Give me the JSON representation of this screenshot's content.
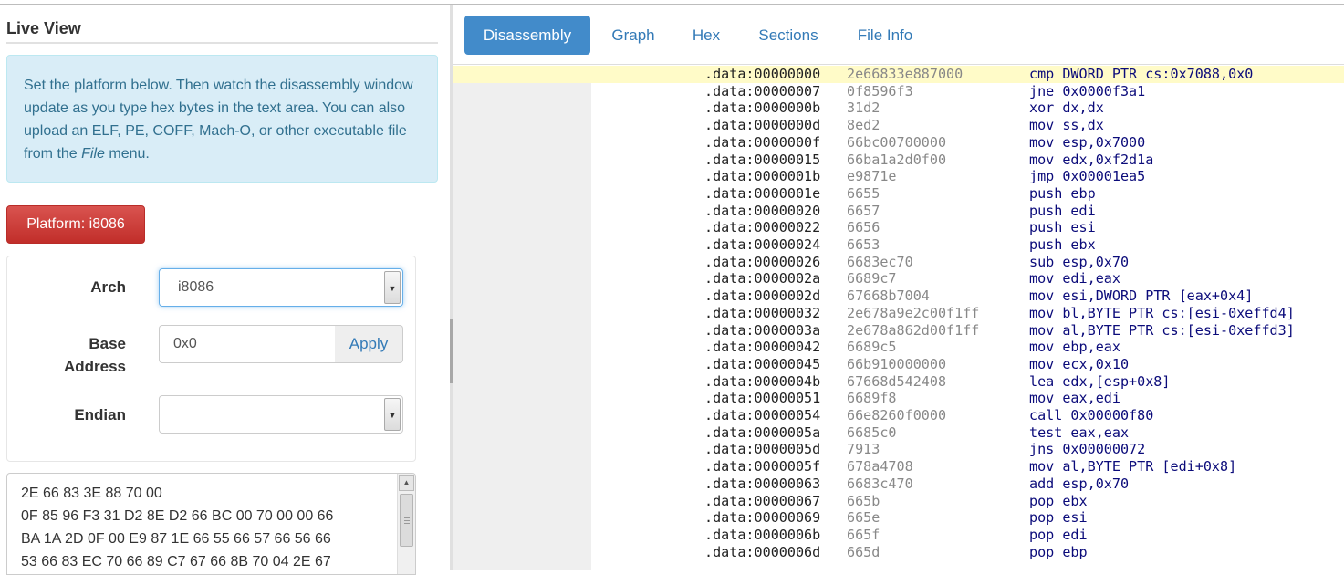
{
  "left_panel": {
    "title": "Live View",
    "info": {
      "text_before": "Set the platform below. Then watch the disassembly window update as you type hex bytes in the text area. You can also upload an ELF, PE, COFF, Mach-O, or other executable file from the ",
      "file_word": "File",
      "text_after": " menu."
    },
    "platform_button": "Platform: i8086",
    "form": {
      "arch_label": "Arch",
      "arch_value": "i8086",
      "base_label_1": "Base",
      "base_label_2": "Address",
      "base_value": "0x0",
      "apply_label": "Apply",
      "endian_label": "Endian",
      "endian_value": ""
    },
    "hex_lines": [
      "2E 66 83 3E 88 70 00",
      "0F 85 96 F3 31 D2 8E D2 66 BC 00 70 00 00 66",
      "BA 1A 2D 0F 00 E9 87 1E 66 55 66 57 66 56 66",
      "53 66 83 EC 70 66 89 C7 67 66 8B 70 04 2E 67"
    ]
  },
  "tabs": [
    "Disassembly",
    "Graph",
    "Hex",
    "Sections",
    "File Info"
  ],
  "active_tab": "Disassembly",
  "disassembly": [
    {
      "addr": ".data:00000000",
      "bytes": "2e66833e887000",
      "ins": "cmp DWORD PTR cs:0x7088,0x0"
    },
    {
      "addr": ".data:00000007",
      "bytes": "0f8596f3",
      "ins": "jne 0x0000f3a1"
    },
    {
      "addr": ".data:0000000b",
      "bytes": "31d2",
      "ins": "xor dx,dx"
    },
    {
      "addr": ".data:0000000d",
      "bytes": "8ed2",
      "ins": "mov ss,dx"
    },
    {
      "addr": ".data:0000000f",
      "bytes": "66bc00700000",
      "ins": "mov esp,0x7000"
    },
    {
      "addr": ".data:00000015",
      "bytes": "66ba1a2d0f00",
      "ins": "mov edx,0xf2d1a"
    },
    {
      "addr": ".data:0000001b",
      "bytes": "e9871e",
      "ins": "jmp 0x00001ea5"
    },
    {
      "addr": ".data:0000001e",
      "bytes": "6655",
      "ins": "push ebp"
    },
    {
      "addr": ".data:00000020",
      "bytes": "6657",
      "ins": "push edi"
    },
    {
      "addr": ".data:00000022",
      "bytes": "6656",
      "ins": "push esi"
    },
    {
      "addr": ".data:00000024",
      "bytes": "6653",
      "ins": "push ebx"
    },
    {
      "addr": ".data:00000026",
      "bytes": "6683ec70",
      "ins": "sub esp,0x70"
    },
    {
      "addr": ".data:0000002a",
      "bytes": "6689c7",
      "ins": "mov edi,eax"
    },
    {
      "addr": ".data:0000002d",
      "bytes": "67668b7004",
      "ins": "mov esi,DWORD PTR [eax+0x4]"
    },
    {
      "addr": ".data:00000032",
      "bytes": "2e678a9e2c00f1ff",
      "ins": "mov bl,BYTE PTR cs:[esi-0xeffd4]"
    },
    {
      "addr": ".data:0000003a",
      "bytes": "2e678a862d00f1ff",
      "ins": "mov al,BYTE PTR cs:[esi-0xeffd3]"
    },
    {
      "addr": ".data:00000042",
      "bytes": "6689c5",
      "ins": "mov ebp,eax"
    },
    {
      "addr": ".data:00000045",
      "bytes": "66b910000000",
      "ins": "mov ecx,0x10"
    },
    {
      "addr": ".data:0000004b",
      "bytes": "67668d542408",
      "ins": "lea edx,[esp+0x8]"
    },
    {
      "addr": ".data:00000051",
      "bytes": "6689f8",
      "ins": "mov eax,edi"
    },
    {
      "addr": ".data:00000054",
      "bytes": "66e8260f0000",
      "ins": "call 0x00000f80"
    },
    {
      "addr": ".data:0000005a",
      "bytes": "6685c0",
      "ins": "test eax,eax"
    },
    {
      "addr": ".data:0000005d",
      "bytes": "7913",
      "ins": "jns 0x00000072"
    },
    {
      "addr": ".data:0000005f",
      "bytes": "678a4708",
      "ins": "mov al,BYTE PTR [edi+0x8]"
    },
    {
      "addr": ".data:00000063",
      "bytes": "6683c470",
      "ins": "add esp,0x70"
    },
    {
      "addr": ".data:00000067",
      "bytes": "665b",
      "ins": "pop ebx"
    },
    {
      "addr": ".data:00000069",
      "bytes": "665e",
      "ins": "pop esi"
    },
    {
      "addr": ".data:0000006b",
      "bytes": "665f",
      "ins": "pop edi"
    },
    {
      "addr": ".data:0000006d",
      "bytes": "665d",
      "ins": "pop ebp"
    }
  ],
  "highlight_row": 0
}
